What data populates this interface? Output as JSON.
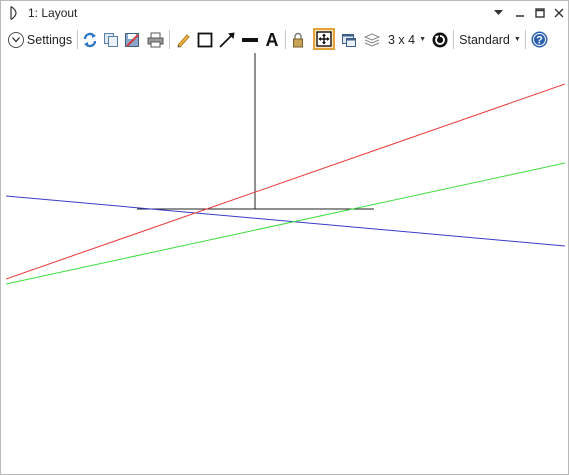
{
  "window": {
    "title": "1: Layout"
  },
  "toolbar": {
    "settings_label": "Settings",
    "layers_label": "3 x 4",
    "view_label": "Standard",
    "icons": [
      "refresh-icon",
      "copy-icon",
      "save-icon",
      "print-icon",
      "pencil-icon",
      "rectangle-icon",
      "arrow-icon",
      "line-icon",
      "text-icon",
      "lock-icon",
      "fit-window-icon",
      "windows-icon",
      "layers-icon",
      "rotate-icon",
      "help-icon"
    ]
  },
  "colors": {
    "accent_active": "#e8a23a",
    "ray_red": "#e8393a",
    "ray_green": "#3fdc3f",
    "ray_blue": "#3a3ac8",
    "element": "#202020"
  }
}
